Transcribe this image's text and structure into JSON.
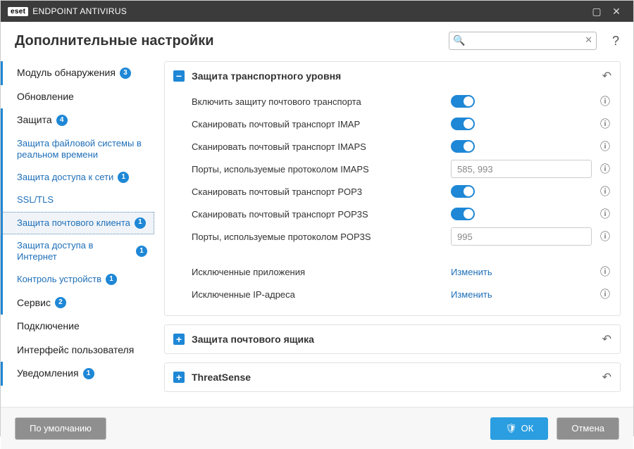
{
  "titlebar": {
    "brand_badge": "eset",
    "brand_text": "ENDPOINT ANTIVIRUS"
  },
  "header": {
    "title": "Дополнительные настройки",
    "search_placeholder": "",
    "help": "?"
  },
  "sidebar": {
    "items": [
      {
        "label": "Модуль обнаружения",
        "badge": "3",
        "kind": "top",
        "accent": true
      },
      {
        "label": "Обновление",
        "badge": "",
        "kind": "top",
        "accent": false
      },
      {
        "label": "Защита",
        "badge": "4",
        "kind": "top",
        "accent": true
      },
      {
        "label": "Защита файловой системы в реальном времени",
        "badge": "",
        "kind": "sub"
      },
      {
        "label": "Защита доступа к сети",
        "badge": "1",
        "kind": "sub"
      },
      {
        "label": "SSL/TLS",
        "badge": "",
        "kind": "sub"
      },
      {
        "label": "Защита почтового клиента",
        "badge": "1",
        "kind": "sub",
        "selected": true
      },
      {
        "label": "Защита доступа в Интернет",
        "badge": "1",
        "kind": "sub"
      },
      {
        "label": "Контроль устройств",
        "badge": "1",
        "kind": "sub"
      },
      {
        "label": "Сервис",
        "badge": "2",
        "kind": "top",
        "accent": true
      },
      {
        "label": "Подключение",
        "badge": "",
        "kind": "top",
        "accent": false
      },
      {
        "label": "Интерфейс пользователя",
        "badge": "",
        "kind": "top",
        "accent": false
      },
      {
        "label": "Уведомления",
        "badge": "1",
        "kind": "top",
        "accent": true
      }
    ]
  },
  "panels": {
    "transport": {
      "title": "Защита транспортного уровня",
      "expanded": true,
      "rows": [
        {
          "label": "Включить защиту почтового транспорта",
          "type": "toggle"
        },
        {
          "label": "Сканировать почтовый транспорт IMAP",
          "type": "toggle"
        },
        {
          "label": "Сканировать почтовый транспорт IMAPS",
          "type": "toggle"
        },
        {
          "label": "Порты, используемые протоколом IMAPS",
          "type": "text",
          "value": "585, 993"
        },
        {
          "label": "Сканировать почтовый транспорт POP3",
          "type": "toggle"
        },
        {
          "label": "Сканировать почтовый транспорт POP3S",
          "type": "toggle"
        },
        {
          "label": "Порты, используемые протоколом POP3S",
          "type": "text",
          "value": "995"
        }
      ],
      "extra": [
        {
          "label": "Исключенные приложения",
          "action": "Изменить"
        },
        {
          "label": "Исключенные IP-адреса",
          "action": "Изменить"
        }
      ]
    },
    "mailbox": {
      "title": "Защита почтового ящика",
      "expanded": false
    },
    "threatsense": {
      "title": "ThreatSense",
      "expanded": false
    }
  },
  "footer": {
    "default": "По умолчанию",
    "ok": "ОК",
    "cancel": "Отмена"
  }
}
